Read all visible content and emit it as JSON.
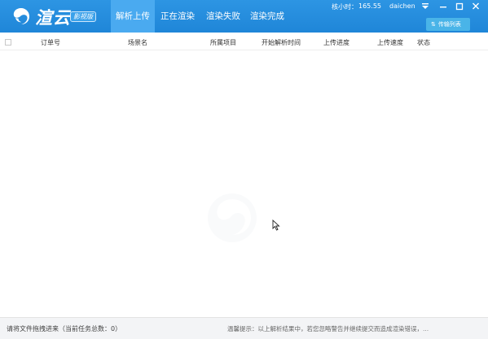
{
  "app": {
    "logo_text": "渲云",
    "edition": "影视版"
  },
  "tabs": [
    {
      "label": "解析上传",
      "active": true
    },
    {
      "label": "正在渲染",
      "active": false
    },
    {
      "label": "渲染失败",
      "active": false
    },
    {
      "label": "渲染完成",
      "active": false
    }
  ],
  "account": {
    "balance_label": "核小时：",
    "balance_value": "165.55",
    "username": "daichen"
  },
  "toolbar": {
    "transfer_list_label": "传输列表"
  },
  "table": {
    "columns": [
      "订单号",
      "场景名",
      "所属项目",
      "开始解析时间",
      "上传进度",
      "上传速度",
      "状态"
    ],
    "rows": []
  },
  "status": {
    "left_text": "请将文件拖拽进来（当前任务总数：0）",
    "right_label": "温馨提示：",
    "right_text": "以上解析结果中，若您忽略警告并继续提交而造成渲染错误，",
    "right_trailing": "..."
  },
  "colors": {
    "titlebar": "#1f86d8",
    "active_tab": "#4aaaf0",
    "transfer_button": "#49b4e8",
    "statusbar": "#f3f4f6"
  },
  "icons": {
    "logo": "cloud-logo-icon",
    "menu": "dropdown-triangle-icon",
    "minimize": "minimize-icon",
    "maximize": "maximize-icon",
    "close": "close-icon",
    "transfer": "transfer-arrows-icon",
    "cursor": "mouse-cursor-icon"
  }
}
